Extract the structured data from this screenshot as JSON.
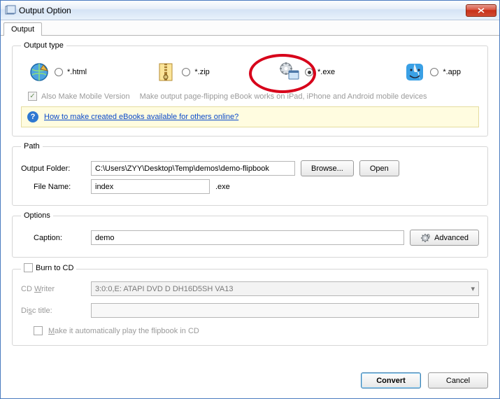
{
  "title": "Output Option",
  "tab": "Output",
  "outputType": {
    "legend": "Output type",
    "html": "*.html",
    "zip": "*.zip",
    "exe": "*.exe",
    "app": "*.app",
    "mobile": "Also Make Mobile Version",
    "mobileHint": "Make output page-flipping eBook works on iPad, iPhone and Android mobile devices",
    "helpLink": "How to make created eBooks available for others online?"
  },
  "path": {
    "legend": "Path",
    "folderLabel": "Output Folder:",
    "folderValue": "C:\\Users\\ZYY\\Desktop\\Temp\\demos\\demo-flipbook",
    "browse": "Browse...",
    "open": "Open",
    "fileLabel": "File Name:",
    "fileValue": "index",
    "ext": ".exe"
  },
  "options": {
    "legend": "Options",
    "captionLabel": "Caption:",
    "captionValue": "demo",
    "advanced": "Advanced"
  },
  "burn": {
    "label": "Burn to CD",
    "writerLabel_pre": "CD ",
    "writerLabel_u": "W",
    "writerLabel_post": "riter",
    "writerValue": "3:0:0,E: ATAPI   DVD D  DH16D5SH  VA13",
    "discLabel_pre": "Di",
    "discLabel_u": "s",
    "discLabel_post": "c title:",
    "auto_pre": "",
    "auto_u": "M",
    "auto_post": "ake it automatically play the flipbook in CD"
  },
  "footer": {
    "convert": "Convert",
    "cancel": "Cancel"
  }
}
